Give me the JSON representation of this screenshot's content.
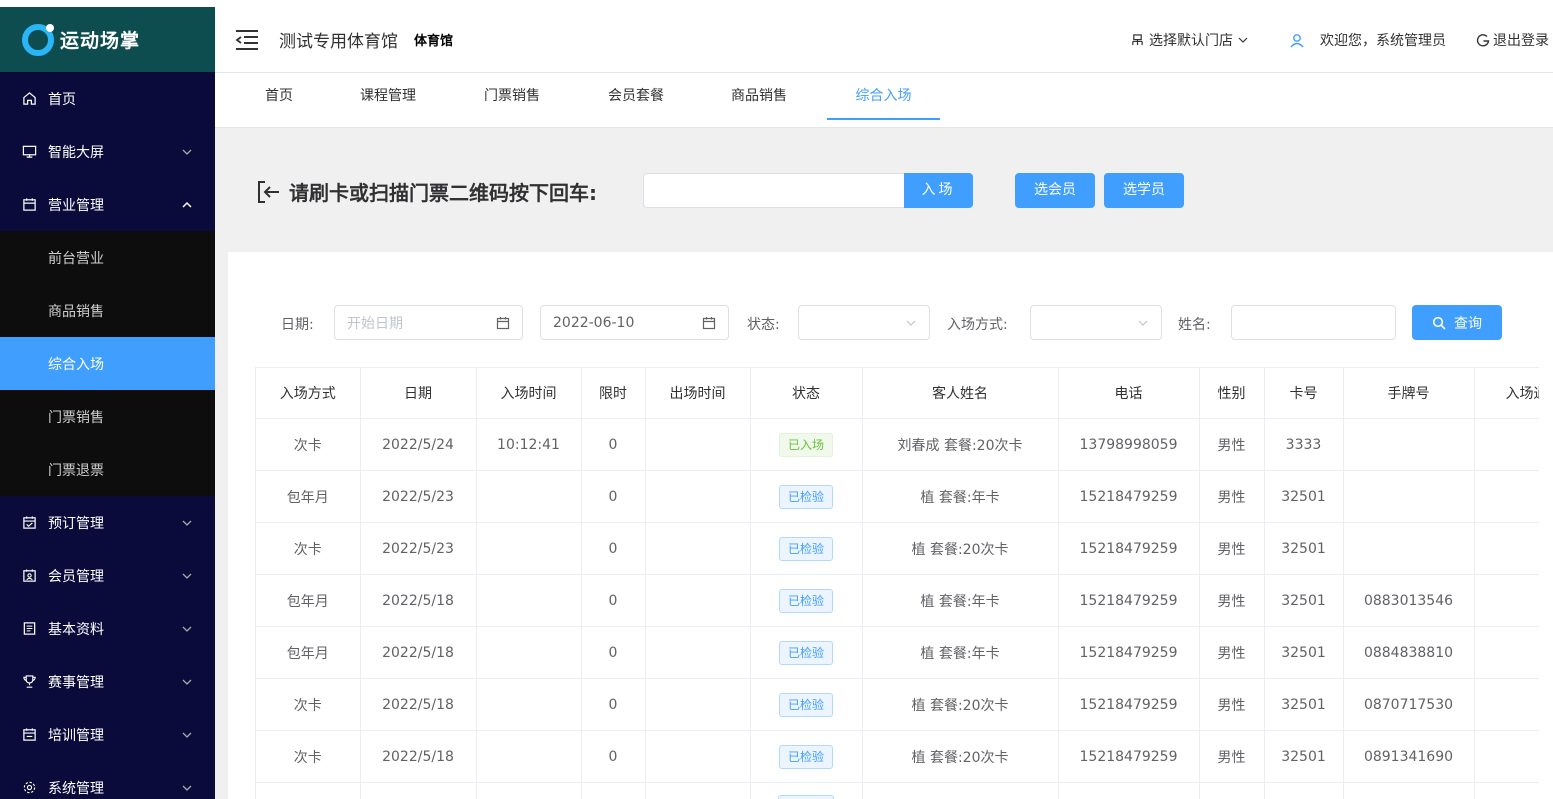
{
  "brand": {
    "name": "运动场掌"
  },
  "sidebar": {
    "items": [
      {
        "label": "首页",
        "icon": "home-icon",
        "has_chevron": false
      },
      {
        "label": "智能大屏",
        "icon": "monitor-icon",
        "has_chevron": true
      },
      {
        "label": "营业管理",
        "icon": "calendar-icon",
        "has_chevron": true,
        "expanded": true
      },
      {
        "label": "预订管理",
        "icon": "booking-icon",
        "has_chevron": true
      },
      {
        "label": "会员管理",
        "icon": "member-card-icon",
        "has_chevron": true
      },
      {
        "label": "基本资料",
        "icon": "document-icon",
        "has_chevron": true
      },
      {
        "label": "赛事管理",
        "icon": "trophy-icon",
        "has_chevron": true
      },
      {
        "label": "培训管理",
        "icon": "training-icon",
        "has_chevron": true
      },
      {
        "label": "系统管理",
        "icon": "gear-icon",
        "has_chevron": true
      }
    ],
    "submenu": [
      {
        "label": "前台营业"
      },
      {
        "label": "商品销售"
      },
      {
        "label": "综合入场",
        "active": true
      },
      {
        "label": "门票销售"
      },
      {
        "label": "门票退票"
      }
    ]
  },
  "header": {
    "venue_title": "测试专用体育馆",
    "venue_subtitle": "体育馆",
    "store_select": "选择默认门店",
    "welcome": "欢迎您，系统管理员",
    "logout": "退出登录"
  },
  "tabs": [
    {
      "label": "首页"
    },
    {
      "label": "课程管理"
    },
    {
      "label": "门票销售"
    },
    {
      "label": "会员套餐"
    },
    {
      "label": "商品销售"
    },
    {
      "label": "综合入场",
      "active": true
    }
  ],
  "scan": {
    "label": "请刷卡或扫描门票二维码按下回车:",
    "enter_button": "入场",
    "select_member_button": "选会员",
    "select_student_button": "选学员"
  },
  "filters": {
    "date_label": "日期:",
    "start_date_placeholder": "开始日期",
    "end_date_value": "2022-06-10",
    "status_label": "状态:",
    "entry_method_label": "入场方式:",
    "name_label": "姓名:",
    "query_button": "查询"
  },
  "table": {
    "columns": [
      "入场方式",
      "日期",
      "入场时间",
      "限时",
      "出场时间",
      "状态",
      "客人姓名",
      "电话",
      "性别",
      "卡号",
      "手牌号",
      "入场通道"
    ],
    "rows": [
      [
        "次卡",
        "2022/5/24",
        "10:12:41",
        "0",
        "",
        "已入场",
        "刘春成 套餐:20次卡",
        "13798998059",
        "男性",
        "3333",
        "",
        ""
      ],
      [
        "包年月",
        "2022/5/23",
        "",
        "0",
        "",
        "已检验",
        "植 套餐:年卡",
        "15218479259",
        "男性",
        "32501",
        "",
        ""
      ],
      [
        "次卡",
        "2022/5/23",
        "",
        "0",
        "",
        "已检验",
        "植 套餐:20次卡",
        "15218479259",
        "男性",
        "32501",
        "",
        ""
      ],
      [
        "包年月",
        "2022/5/18",
        "",
        "0",
        "",
        "已检验",
        "植 套餐:年卡",
        "15218479259",
        "男性",
        "32501",
        "0883013546",
        ""
      ],
      [
        "包年月",
        "2022/5/18",
        "",
        "0",
        "",
        "已检验",
        "植 套餐:年卡",
        "15218479259",
        "男性",
        "32501",
        "0884838810",
        ""
      ],
      [
        "次卡",
        "2022/5/18",
        "",
        "0",
        "",
        "已检验",
        "植 套餐:20次卡",
        "15218479259",
        "男性",
        "32501",
        "0870717530",
        ""
      ],
      [
        "次卡",
        "2022/5/18",
        "",
        "0",
        "",
        "已检验",
        "植 套餐:20次卡",
        "15218479259",
        "男性",
        "32501",
        "0891341690",
        ""
      ],
      [
        "",
        "",
        "",
        "",
        "",
        "",
        "",
        "",
        "",
        "",
        "",
        ""
      ]
    ]
  },
  "colors": {
    "primary": "#409eff",
    "sidebar_bg": "#0b0b3b",
    "logo_bg": "#0e4d4f",
    "submenu_bg": "#0d0d0d",
    "tag_entered": "#67c23a",
    "tag_checked": "#409eff"
  }
}
